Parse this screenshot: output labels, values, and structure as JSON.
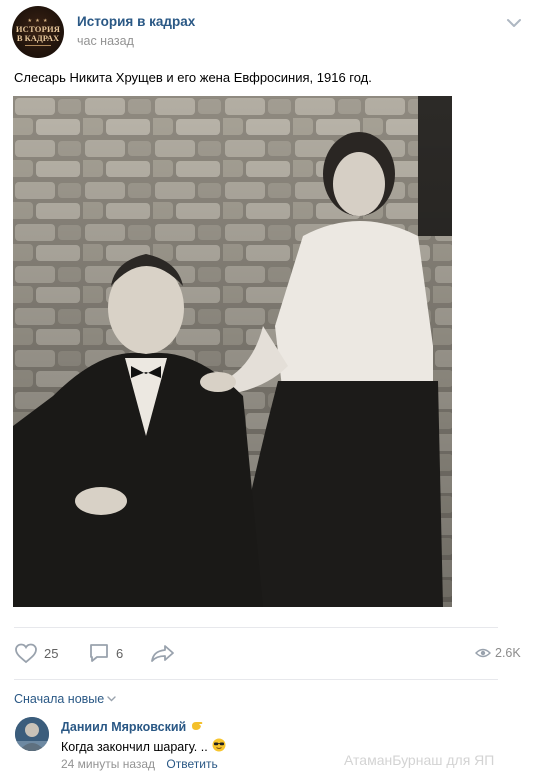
{
  "post": {
    "channel_name": "История в кадрах",
    "time": "час назад",
    "avatar_text": {
      "line1": "ИСТОРИЯ",
      "line2": "В КАДРАХ",
      "stars": "★ ★ ★"
    },
    "text": "Слесарь Никита Хрущев и его жена Евфросиния, 1916 год.",
    "photo_alt": "photo"
  },
  "actions": {
    "likes": "25",
    "comments": "6",
    "views": "2.6K"
  },
  "comments_section": {
    "sort_label": "Сначала новые",
    "comment": {
      "author": "Даниил Мярковский",
      "text": "Когда закончил шарагу. ..",
      "time": "24 минуты назад",
      "reply_label": "Ответить"
    }
  },
  "watermark": "АтаманБурнаш для ЯП",
  "colors": {
    "link": "#2a5885",
    "muted": "#939393",
    "separator": "#e7e8ec"
  }
}
